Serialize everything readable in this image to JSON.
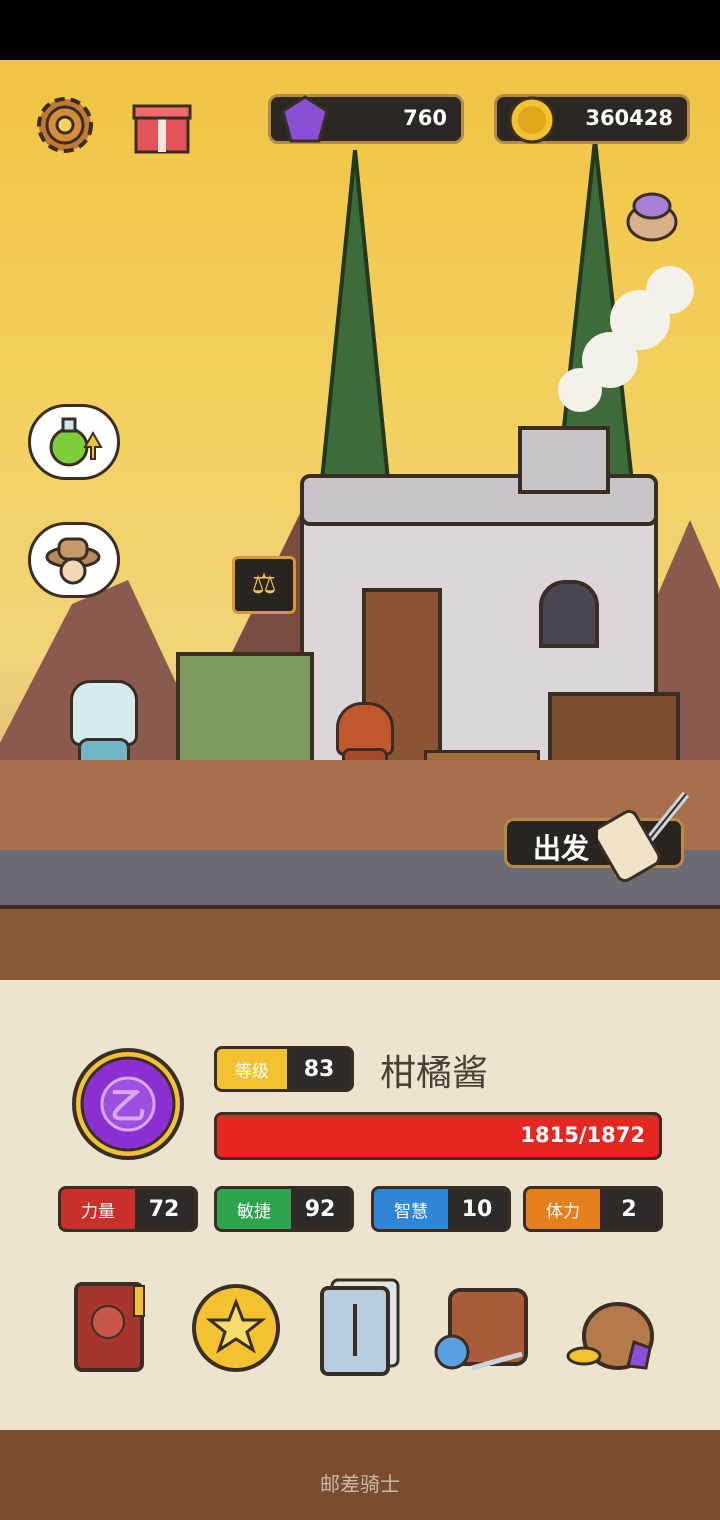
{
  "currency": {
    "gems": "760",
    "gold": "360428"
  },
  "scene": {
    "depart_label": "出发"
  },
  "player": {
    "level_label": "等级",
    "level": "83",
    "name": "柑橘酱",
    "hp": "1815/1872",
    "hp_fraction": 0.9696
  },
  "stats": [
    {
      "label": "力量",
      "value": "72",
      "color": "#c9302c"
    },
    {
      "label": "敏捷",
      "value": "92",
      "color": "#2ea44f"
    },
    {
      "label": "智慧",
      "value": "10",
      "color": "#2f86d6"
    },
    {
      "label": "体力",
      "value": "2",
      "color": "#e6801f"
    }
  ],
  "menu_icons": [
    "hero-book-icon",
    "star-coin-icon",
    "card-deck-icon",
    "backpack-icon",
    "treasure-bag-icon"
  ],
  "footer": {
    "app_name": "邮差骑士"
  },
  "colors": {
    "sky": "#f1c443",
    "panel": "#ede4cf",
    "hp": "#e52621",
    "badge": "#8a2fd1"
  }
}
